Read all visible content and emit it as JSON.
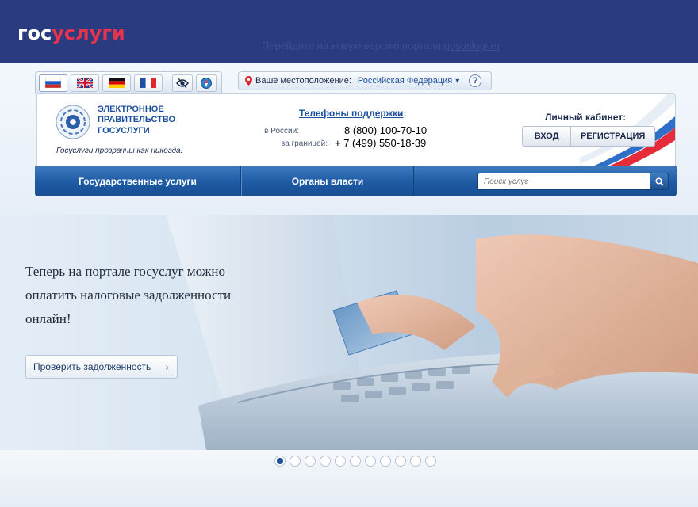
{
  "top": {
    "logo_part1": "гос",
    "logo_part2": "услуги",
    "notice_text": "Перейдите на новую версию портала",
    "notice_link": "gosuslugi.ru"
  },
  "languages": [
    {
      "code": "ru",
      "active": true
    },
    {
      "code": "en",
      "active": false
    },
    {
      "code": "de",
      "active": false
    },
    {
      "code": "fr",
      "active": false
    }
  ],
  "accessibility": {
    "icons": [
      "eye-icon",
      "compass-icon"
    ]
  },
  "location": {
    "label": "Ваше местоположение:",
    "value": "Российская Федерация",
    "help": "?"
  },
  "brand": {
    "line1": "ЭЛЕКТРОННОЕ",
    "line2": "ПРАВИТЕЛЬСТВО",
    "line3": "ГОСУСЛУГИ",
    "slogan": "Госуслуги прозрачны как никогда!"
  },
  "support": {
    "title": "Телефоны поддержки",
    "russia_label": "в России:",
    "russia_phone": "8 (800) 100-70-10",
    "abroad_label": "за границей:",
    "abroad_phone": "+ 7 (499) 550-18-39"
  },
  "cabinet": {
    "title": "Личный кабинет:",
    "login": "ВХОД",
    "register": "РЕГИСТРАЦИЯ"
  },
  "nav": {
    "item1": "Государственные услуги",
    "item2": "Органы власти",
    "search_placeholder": "Поиск услуг"
  },
  "hero": {
    "text": "Теперь на портале госуслуг можно оплатить налоговые задолженности онлайн!",
    "button": "Проверить задолженность"
  },
  "carousel": {
    "count": 11,
    "active": 0
  },
  "colors": {
    "brand_blue": "#2a3b80",
    "brand_red": "#e4334d",
    "nav_blue": "#1e5aa3"
  }
}
